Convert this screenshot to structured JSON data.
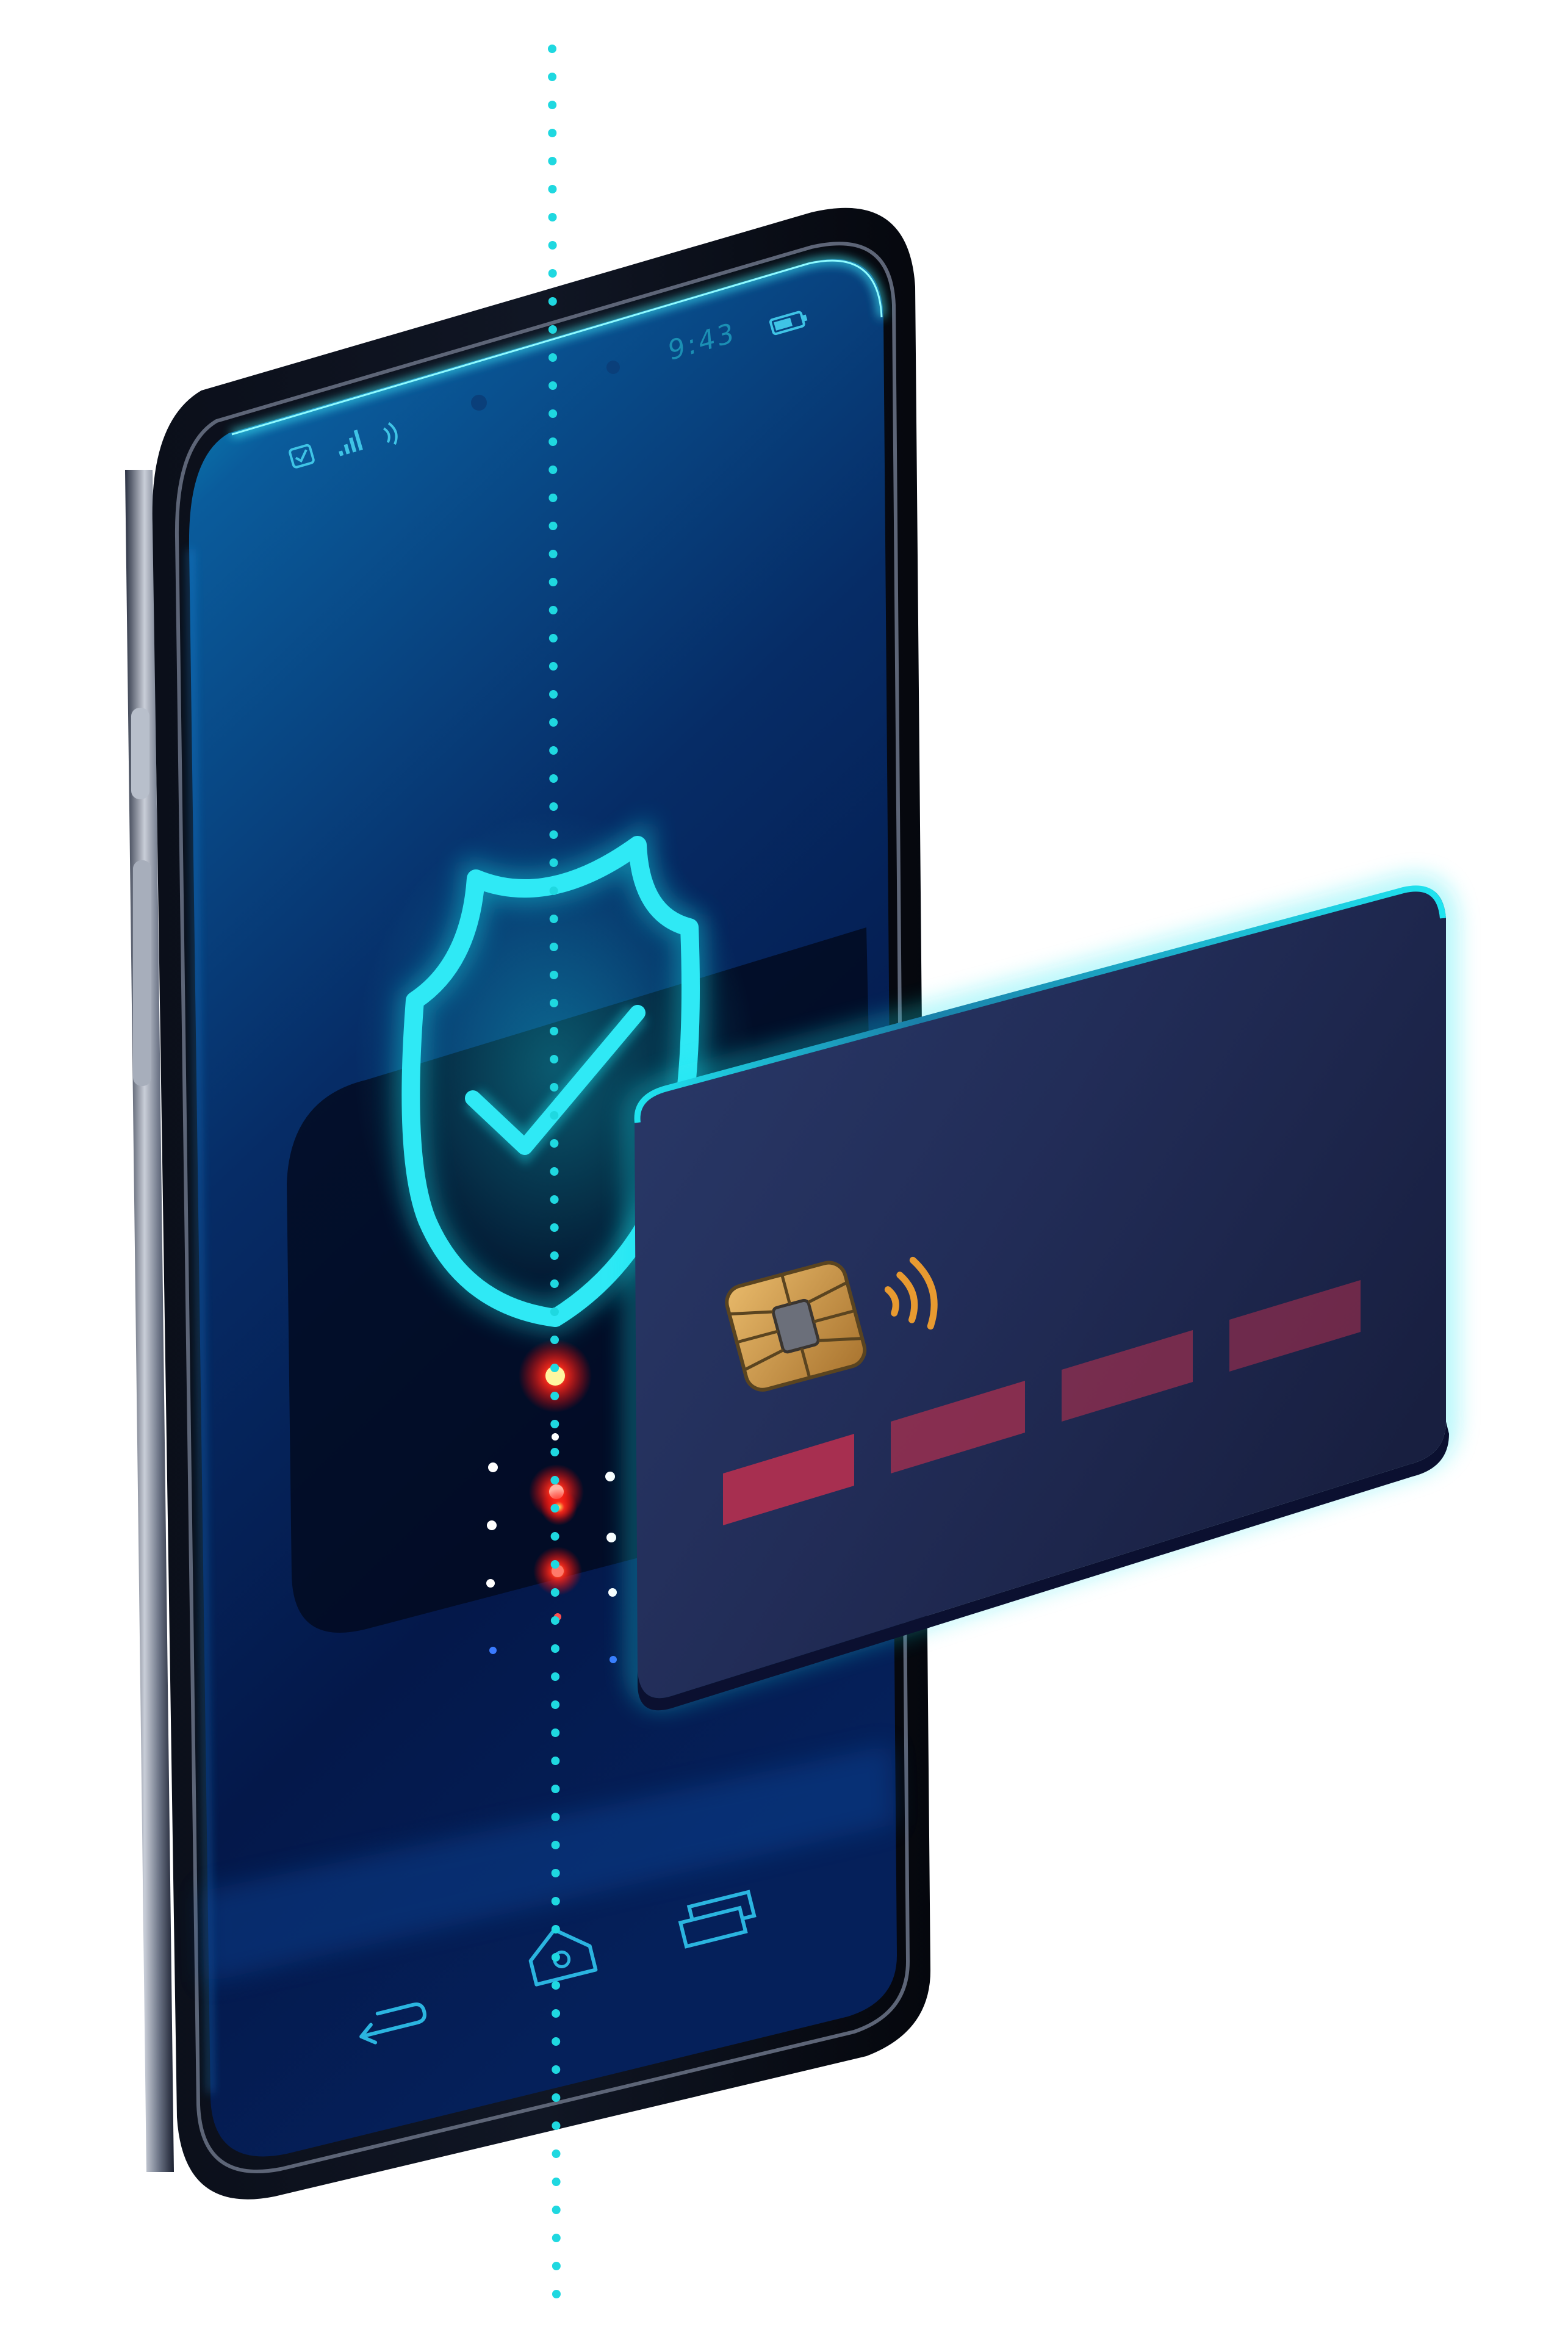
{
  "status_bar": {
    "time": "9:43"
  },
  "icons": {
    "notification": "checkbox-notification-icon",
    "signal": "signal-bars-icon",
    "nfc": "nfc-waves-icon",
    "battery": "battery-icon",
    "shield": "shield-check-icon",
    "back": "back-arrow-icon",
    "home": "home-icon",
    "recents": "recent-apps-icon",
    "card_chip": "chip-icon",
    "card_contactless": "contactless-icon"
  },
  "colors": {
    "screen_top": "#0aa6c9",
    "screen_mid": "#063a78",
    "screen_bottom": "#04103a",
    "accent_cyan": "#19e6f0",
    "card_body": "#1f2a52",
    "card_number_block": "#b3304f",
    "chip_gold": "#c8954a",
    "scan_red": "#ff1a1a",
    "dotted_line": "#1fd8e0"
  },
  "card": {
    "number_groups": 4
  }
}
